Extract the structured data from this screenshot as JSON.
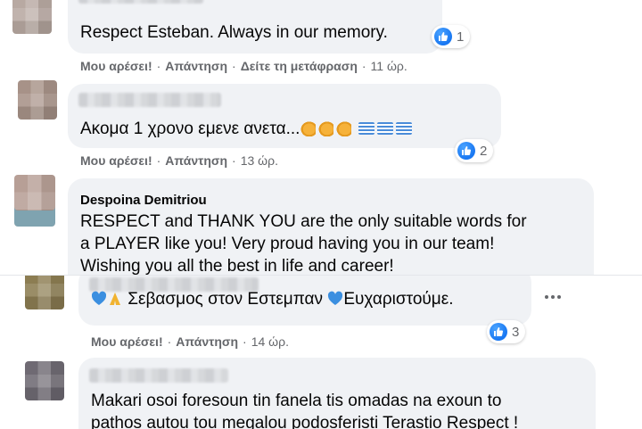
{
  "comments": [
    {
      "text": "Respect Esteban. Always in our memory.",
      "actions": {
        "like": "Μου αρέσει!",
        "reply": "Απάντηση",
        "translate": "Δείτε τη μετάφραση",
        "time": "11 ώρ."
      },
      "reactions": "1"
    },
    {
      "text": "Ακομα 1 χρονο εμενε ανετα...",
      "actions": {
        "like": "Μου αρέσει!",
        "reply": "Απάντηση",
        "time": "13 ώρ."
      },
      "reactions": "2"
    },
    {
      "author": "Despoina Demitriou",
      "lines": [
        "RESPECT and THANK YOU are the only suitable words for",
        "a PLAYER like you! Very proud having you in our team!",
        "Wishing you all the best in life and career!"
      ]
    },
    {
      "text_a": "Σεβασμος στον Εστεμπαν",
      "text_b": "Ευχαριστούμε.",
      "actions": {
        "like": "Μου αρέσει!",
        "reply": "Απάντηση",
        "time": "14 ώρ."
      },
      "reactions": "3"
    },
    {
      "lines": [
        "Makari osoi foresoun tin fanela tis omadas na exoun to",
        "pathos autou tou megalou podosferisti Terastio Respect !"
      ]
    }
  ],
  "separator": "·",
  "colors": {
    "bubble": "#f0f2f5",
    "meta": "#65676b",
    "like_blue": "#1877f2",
    "heart_blue": "#3b8fe0"
  },
  "icons": {
    "like": "thumbs-up-icon",
    "more": "more-horizontal-icon"
  }
}
